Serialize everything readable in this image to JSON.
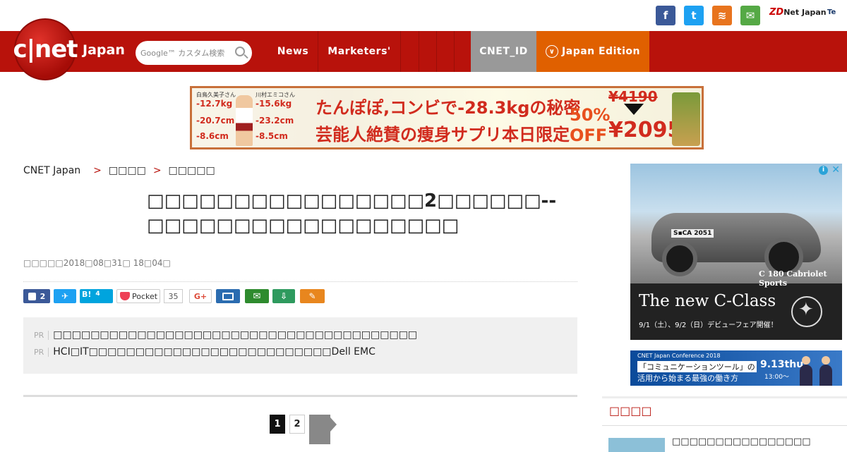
{
  "social": {
    "facebook_glyph": "f",
    "twitter_glyph": "t",
    "rss_glyph": "≋",
    "mail_glyph": "✉",
    "colors": {
      "facebook": "#3b5998",
      "twitter": "#1da1f2",
      "rss": "#e8741e",
      "mail": "#55a945"
    }
  },
  "network": {
    "zd": "ZD",
    "zdnet": "Net Japan",
    "tech": "Te"
  },
  "header": {
    "logo_text": "c|net",
    "logo_suffix": "Japan",
    "search_placeholder": "Google™ カスタム検索",
    "nav": {
      "news": "News",
      "marketers": "Marketers'",
      "cnet_id": "CNET_ID",
      "edition": "Japan Edition"
    },
    "colors": {
      "brand": "#b8120b",
      "cnet_id_bg": "#999999",
      "edition_bg": "#e06000"
    }
  },
  "ad_banner": {
    "p1_name": "白鳥久美子さん",
    "p1_v1": "-12.7kg",
    "p1_v2": "-20.7cm",
    "p1_v3": "-8.6cm",
    "p2_name": "川村エミコさん",
    "p2_v1": "-15.6kg",
    "p2_v2": "-23.2cm",
    "p2_v3": "-8.5cm",
    "line1": "たんぽぽ,コンビで-28.3kgの秘密",
    "line2": "芸能人絶賛の痩身サプリ本日限定",
    "off_pct": "50%",
    "off_word": "OFF",
    "price_old": "¥4190",
    "price_new": "¥2095"
  },
  "breadcrumb": {
    "home": "CNET Japan",
    "sep": ">",
    "level1": "□□□□",
    "level2": "□□□□□"
  },
  "article": {
    "title": "□□□□□□□□□□□□□□□□2□□□□□□--□□□□□□□□□□□□□□□□□□",
    "date": "□□□□□2018□08□31□ 18□04□"
  },
  "share": {
    "fb_count": "2",
    "hatena_label": "B!",
    "hatena_count": "4",
    "pocket_label": "Pocket",
    "pocket_count": "35",
    "gplus_label": "G+"
  },
  "pr": {
    "tag": "PR",
    "item1": "□□□□□□□□□□□□□□□□□□□□□□□□□□□□□□□□□□□□□□□",
    "item2": "HCI□IT□□□□□□□□□□□□□□□□□□□□□□□□□□Dell EMC"
  },
  "pagination": {
    "page1": "1",
    "page2": "2"
  },
  "side_ad": {
    "plate": "S▪CA 2051",
    "model": "C 180 Cabriolet Sports",
    "headline": "The new C-Class",
    "sub": "9/1（土）、9/2（日）デビューフェア開催！",
    "adchoice": "i",
    "close": "✕"
  },
  "conf_banner": {
    "small": "CNET Japan Conference 2018",
    "line1": "「コミュニケーションツール」の",
    "line2": "活用から始まる最強の働き方",
    "date": "9.13thu",
    "time": "13:00〜"
  },
  "sidebar": {
    "heading": "□□□□",
    "item_text": "□□□□□□□□□□□□□□□□"
  }
}
